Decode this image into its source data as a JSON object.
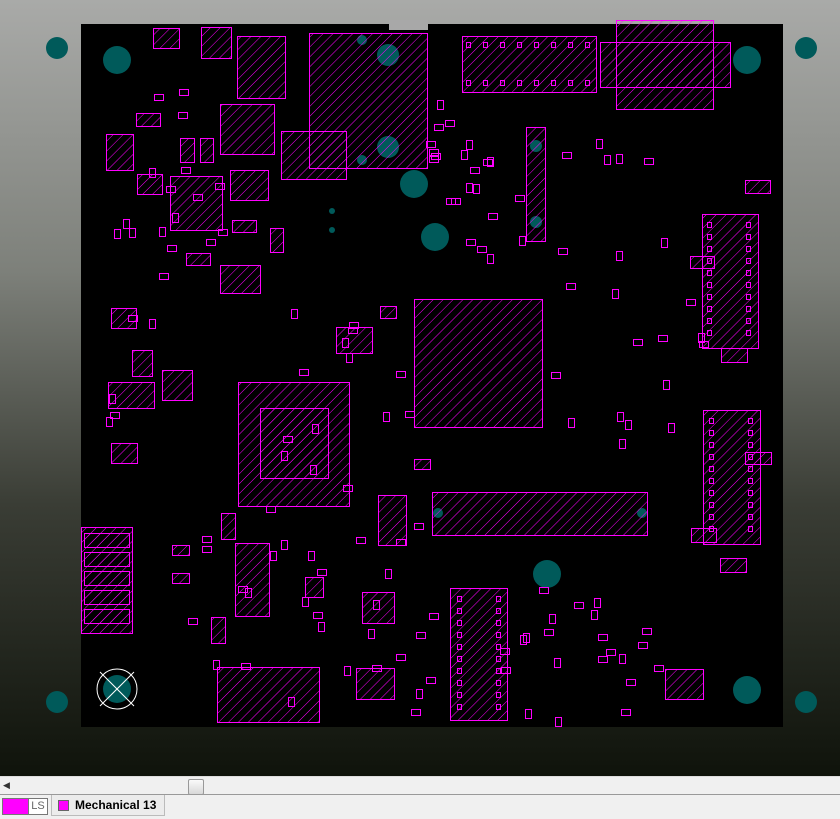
{
  "colors": {
    "layer": "#ff00ff",
    "hole": "#005a5a",
    "board": "#000000"
  },
  "layer_bar": {
    "ls_label": "LS",
    "active_layer": "Mechanical 13"
  },
  "scrollbar": {
    "left_arrow_icon": "triangle-left-icon"
  }
}
